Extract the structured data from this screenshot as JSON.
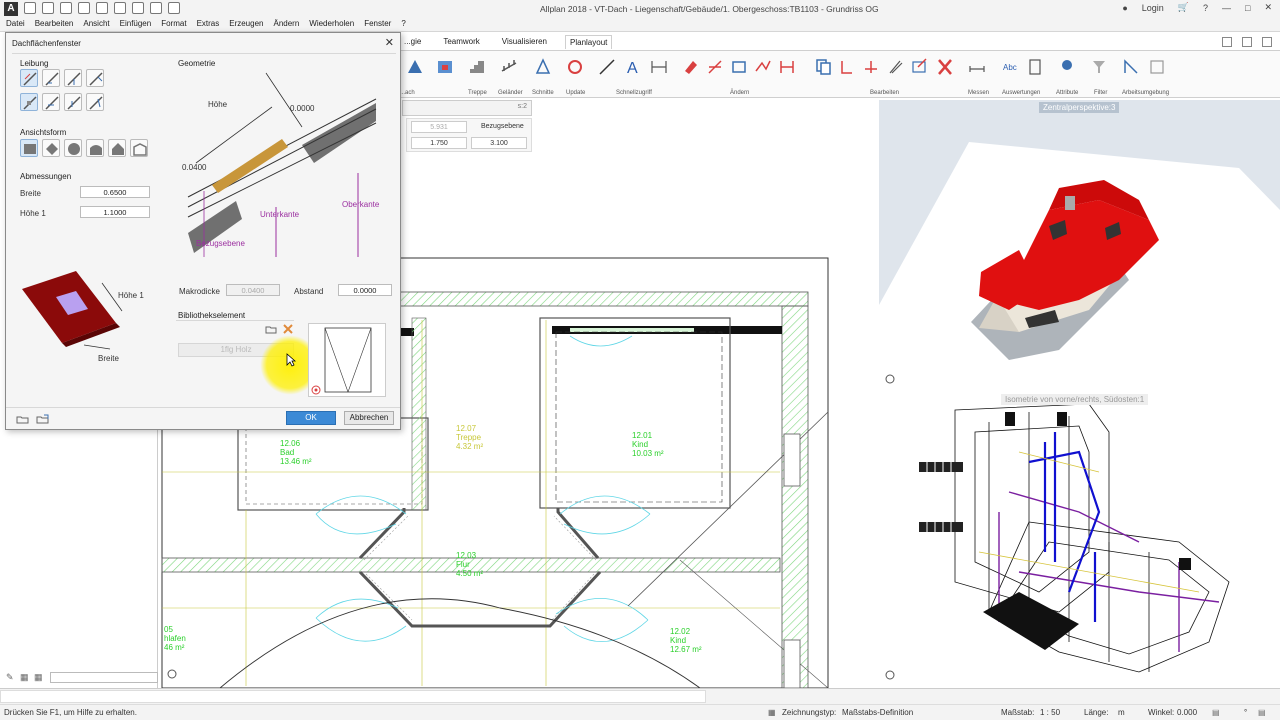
{
  "app": {
    "title": "Allplan 2018 - VT-Dach - Liegenschaft/Gebäude/1. Obergeschoss:TB1103 - Grundriss OG",
    "icon_letter": "A",
    "login_label": "Login"
  },
  "menu": [
    "Datei",
    "Bearbeiten",
    "Ansicht",
    "Einfügen",
    "Format",
    "Extras",
    "Erzeugen",
    "Ändern",
    "Wiederholen",
    "Fenster",
    "?"
  ],
  "ribbon": {
    "tabs": [
      "...gie",
      "Teamwork",
      "Visualisieren",
      "Planlayout"
    ],
    "active_tab": "Planlayout",
    "groups": [
      "...ach",
      "Treppe",
      "Geländer",
      "Schnitte",
      "Update",
      "Schnellzugriff",
      "Ändern",
      "Bearbeiten",
      "Messen",
      "Auswertungen",
      "Attribute",
      "Filter",
      "Arbeitsumgebung"
    ]
  },
  "dialog": {
    "title": "Dachflächenfenster",
    "leibung_label": "Leibung",
    "ansichtsform_label": "Ansichtsform",
    "abmessungen_label": "Abmessungen",
    "breite_label": "Breite",
    "breite_value": "0.6500",
    "hoehe1_label": "Höhe 1",
    "hoehe1_value": "1.1000",
    "preview_hoehe1": "Höhe 1",
    "preview_breite": "Breite",
    "geometrie_label": "Geometrie",
    "geo_hoehe": "Höhe",
    "geo_value1": "0.0000",
    "geo_value2": "0.0400",
    "geo_unterkante": "Unterkante",
    "geo_oberkante": "Oberkante",
    "geo_bezugsebene": "Bezugsebene",
    "makrodicke_label": "Makrodicke",
    "makrodicke_value": "0.0400",
    "abstand_label": "Abstand",
    "abstand_value": "0.0000",
    "bibliothek_label": "Bibliothekselement",
    "bibliothek_button": "1flg Holz",
    "ok_label": "OK",
    "cancel_label": "Abbrechen"
  },
  "drawing": {
    "tab_label": "s:2",
    "info": {
      "val_grey": "5.931",
      "bezugsebene_label": "Bezugsebene",
      "val1": "1.750",
      "val2": "3.100"
    },
    "rooms": [
      {
        "text": "12.06\nBad\n13.46 m²"
      },
      {
        "text": "12.07\nTreppe\n4.32 m²"
      },
      {
        "text": "12.01\nKind\n10.03 m²"
      },
      {
        "text": "12.03\nFlur\n4.50 m²"
      },
      {
        "text": "12.02\nKind\n12.67 m²"
      },
      {
        "text": "05\nhlafen\n46 m²"
      }
    ]
  },
  "viewports": {
    "perspective_label": "Zentralperspektive:3",
    "iso_label": "Isometrie von vorne/rechts, Südosten:1"
  },
  "status": {
    "help": "Drücken Sie F1, um Hilfe zu erhalten.",
    "zeichnungstyp_label": "Zeichnungstyp:",
    "zeichnungstyp_value": "Maßstabs-Definition",
    "massstab_label": "Maßstab:",
    "massstab_value": "1 : 50",
    "laenge_label": "Länge:",
    "laenge_value": "m",
    "winkel_label": "Winkel:",
    "winkel_value": "0.000",
    "grad": "°"
  },
  "colors": {
    "accent": "#3c8ad6",
    "roof": "#e01010",
    "room_text": "#2bd02b",
    "hatch": "#7fd67f"
  }
}
